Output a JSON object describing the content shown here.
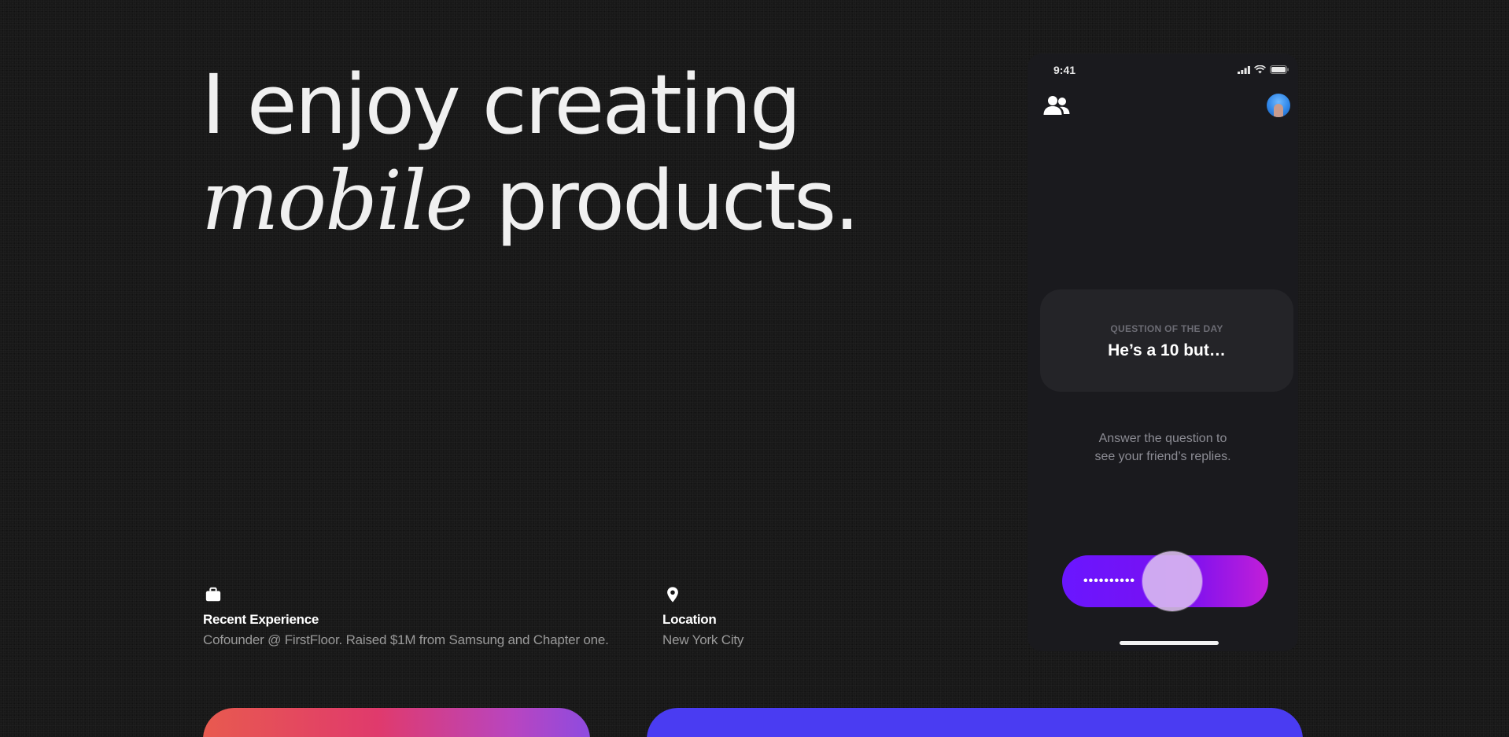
{
  "hero": {
    "line1": "I enjoy creating",
    "line2_italic": "mobile",
    "line2_rest": "products."
  },
  "info": {
    "experience": {
      "icon": "briefcase-icon",
      "label": "Recent Experience",
      "value": "Cofounder @ FirstFloor. Raised $1M from Samsung and Chapter one."
    },
    "location": {
      "icon": "map-pin-icon",
      "label": "Location",
      "value": "New York City"
    }
  },
  "phone": {
    "status_time": "9:41",
    "question_label": "QUESTION OF THE DAY",
    "question_text": "He’s a 10 but…",
    "hint_line1": "Answer the question to",
    "hint_line2": "see your friend’s replies.",
    "slider_dots": "••••••••••"
  },
  "colors": {
    "background": "#181818",
    "slider_start": "#6a16ff",
    "slider_end": "#c21fd8",
    "card_a_start": "#e85a4f",
    "card_a_end": "#8e4be0",
    "card_b": "#4a3cf2"
  }
}
